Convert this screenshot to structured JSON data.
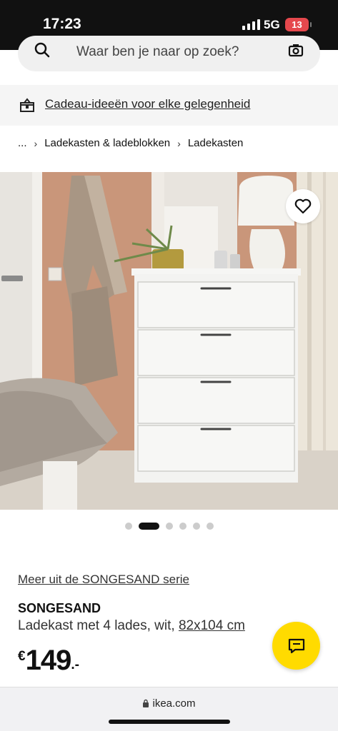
{
  "status_bar": {
    "time": "17:23",
    "network": "5G",
    "battery": "13"
  },
  "search": {
    "placeholder": "Waar ben je naar op zoek?"
  },
  "gift_banner": {
    "text": "Cadeau-ideeën voor elke gelegenheid"
  },
  "breadcrumb": {
    "ellipsis": "...",
    "items": [
      "Ladekasten & ladeblokken",
      "Ladekasten"
    ]
  },
  "carousel": {
    "count": 6,
    "active_index": 1
  },
  "product": {
    "series_link": "Meer uit de SONGESAND serie",
    "name": "SONGESAND",
    "description": "Ladekast met 4 lades, wit,",
    "size": "82x104 cm",
    "price_currency": "€",
    "price_amount": "149",
    "price_suffix": ".-"
  },
  "browser": {
    "url": "ikea.com"
  },
  "colors": {
    "brand_yellow": "#ffdb00",
    "battery_red": "#e5484d"
  },
  "icons": [
    "search-icon",
    "camera-icon",
    "gift-icon",
    "heart-icon",
    "chat-icon",
    "lock-icon"
  ]
}
